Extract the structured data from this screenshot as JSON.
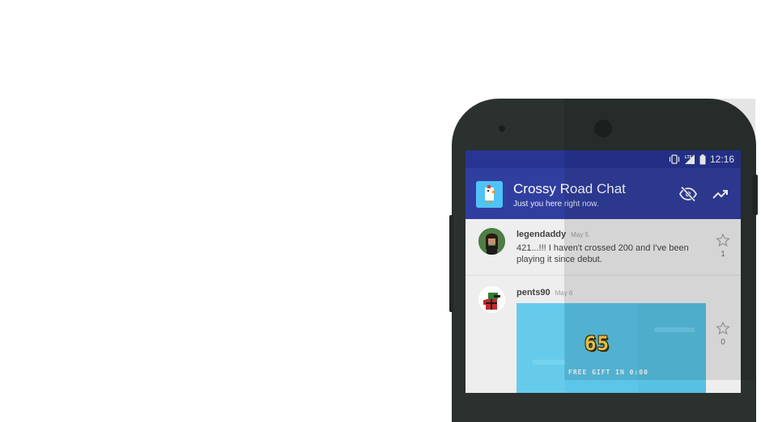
{
  "status_bar": {
    "time": "12:16",
    "icons": [
      "vibrate-icon",
      "lte-signal-icon",
      "battery-icon"
    ]
  },
  "app_bar": {
    "title": "Crossy Road Chat",
    "subtitle": "Just you here right now.",
    "avatar_icon": "crossy-road-chicken-icon",
    "actions": [
      "hide-icon",
      "trending-icon"
    ]
  },
  "messages": [
    {
      "username": "legendaddy",
      "date": "May 5",
      "text": "421...!!! I haven't crossed 200 and I've been playing it since debut.",
      "star_count": "1"
    },
    {
      "username": "pents90",
      "date": "May 6",
      "media": {
        "score": "65",
        "caption": "FREE GIFT IN 0:00"
      },
      "star_count": "0"
    }
  ],
  "colors": {
    "status_bar": "#283593",
    "app_bar": "#303f9f",
    "phone_body": "#2b312f",
    "background": "#eeeeee"
  }
}
